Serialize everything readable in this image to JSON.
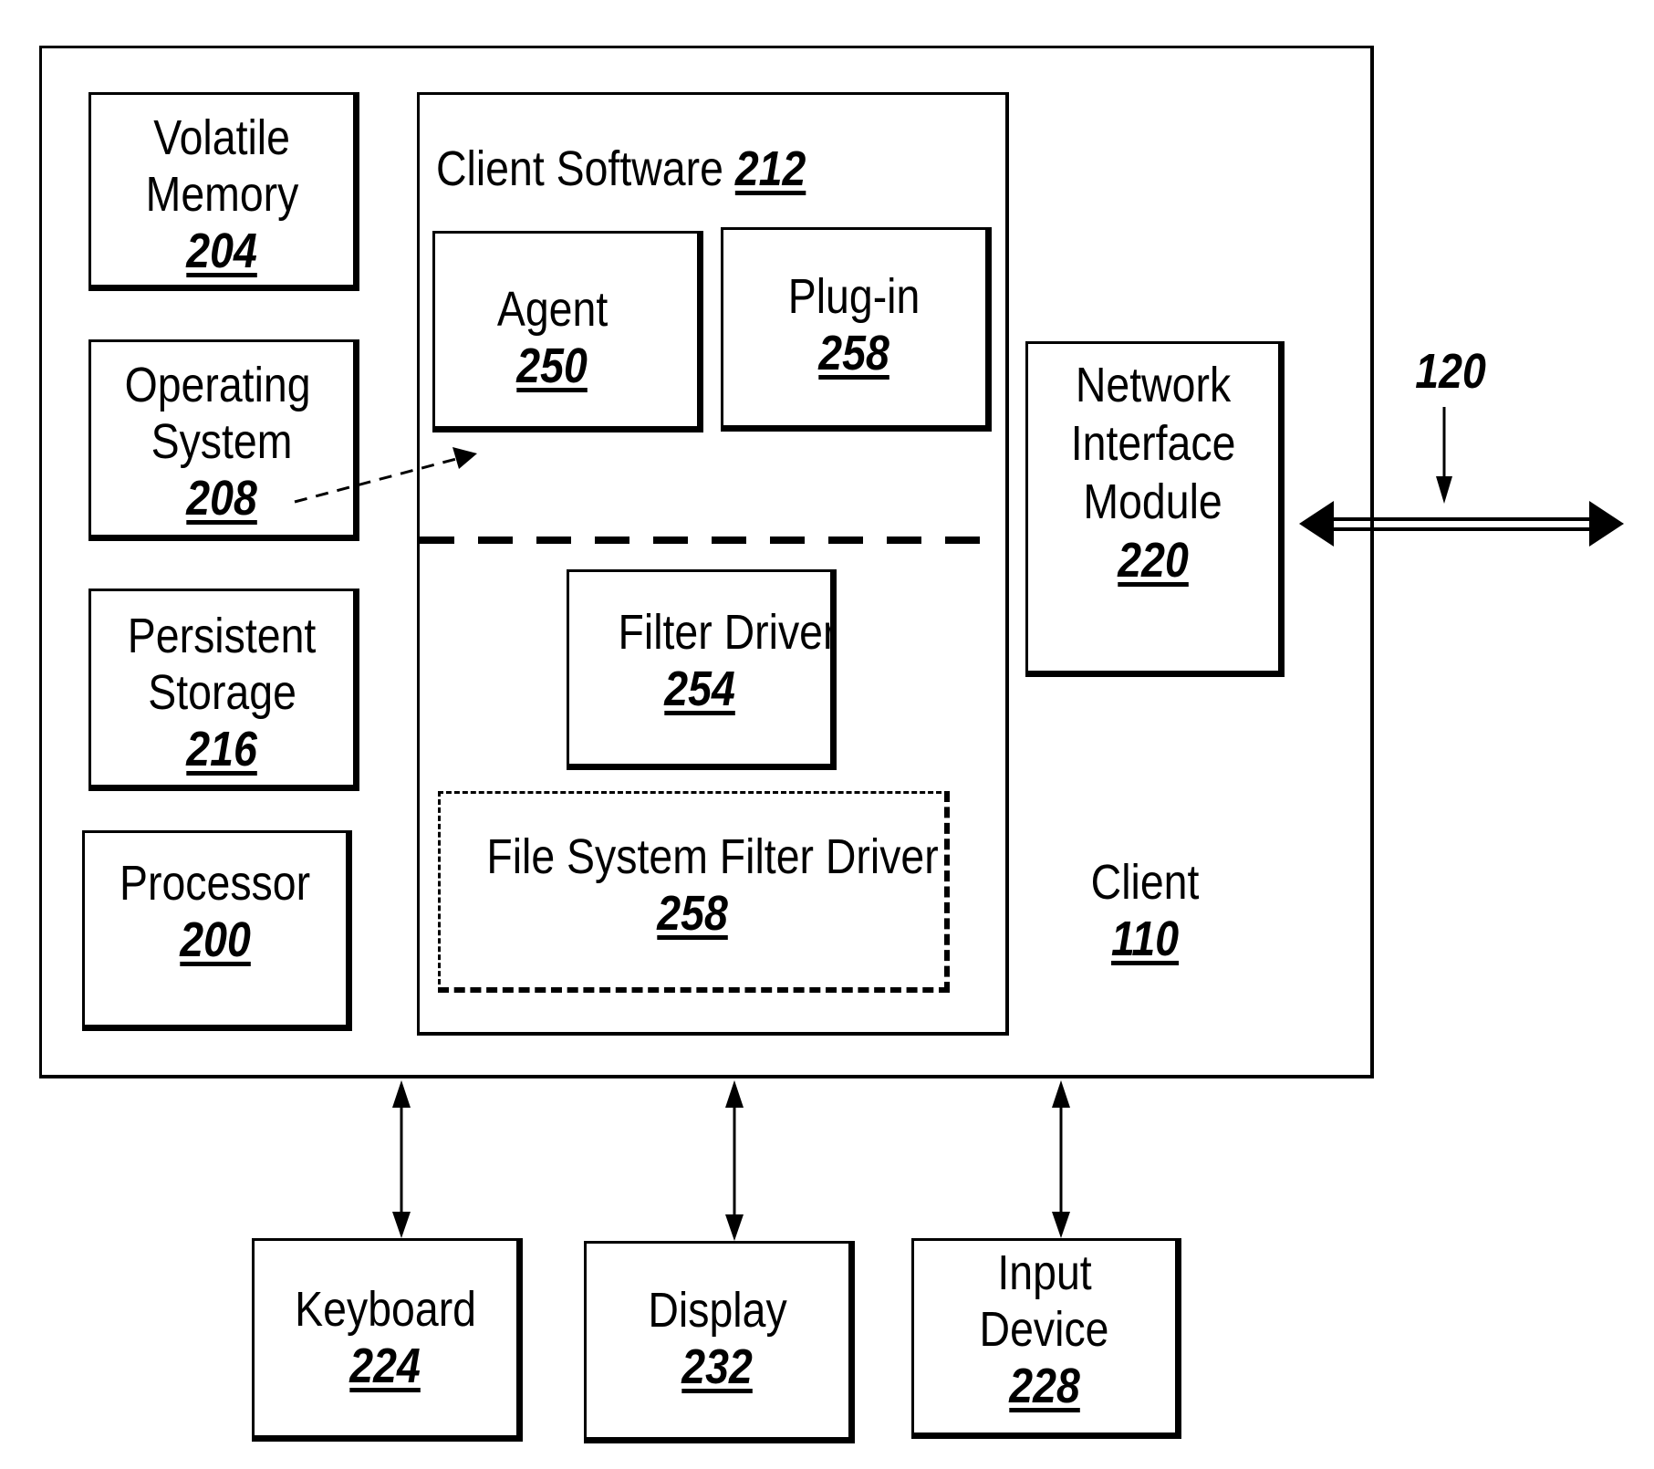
{
  "client": {
    "title": "Client",
    "ref": "110"
  },
  "volatile_memory": {
    "line1": "Volatile",
    "line2": "Memory",
    "ref": "204"
  },
  "operating_system": {
    "line1": "Operating",
    "line2": "System",
    "ref": "208"
  },
  "persistent_storage": {
    "line1": "Persistent",
    "line2": "Storage",
    "ref": "216"
  },
  "processor": {
    "line1": "Processor",
    "ref": "200"
  },
  "client_software": {
    "title": "Client Software",
    "ref": "212"
  },
  "agent": {
    "line1": "Agent",
    "ref": "250"
  },
  "plugin": {
    "line1": "Plug-in",
    "ref": "258"
  },
  "filter_driver": {
    "line1": "Filter Driver",
    "ref": "254"
  },
  "fs_filter_driver": {
    "line1": "File System Filter Driver",
    "ref": "258"
  },
  "network_interface": {
    "line1": "Network",
    "line2": "Interface",
    "line3": "Module",
    "ref": "220"
  },
  "network": {
    "ref": "120"
  },
  "keyboard": {
    "line1": "Keyboard",
    "ref": "224"
  },
  "display": {
    "line1": "Display",
    "ref": "232"
  },
  "input_device": {
    "line1": "Input",
    "line2": "Device",
    "ref": "228"
  }
}
